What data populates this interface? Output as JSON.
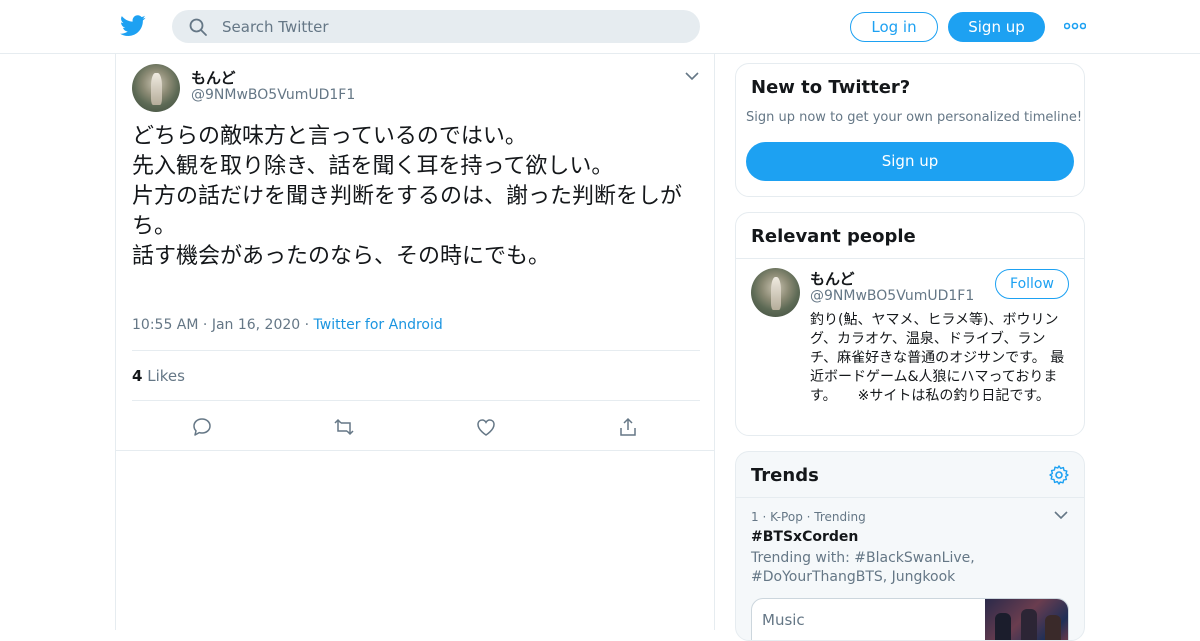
{
  "header": {
    "search_placeholder": "Search Twitter",
    "login_label": "Log in",
    "signup_label": "Sign up",
    "brand_color": "#1da1f2"
  },
  "tweet": {
    "author_name": "もんど",
    "author_handle": "@9NMwBO5VumUD1F1",
    "body_lines": [
      "どちらの敵味方と言っているのではい。",
      "先入観を取り除き、話を聞く耳を持って欲しい。",
      "",
      "片方の話だけを聞き判断をするのは、謝った判断をしがち。",
      "話す機会があったのなら、その時にでも。"
    ],
    "time": "10:55 AM",
    "date": "Jan 16, 2020",
    "source": "Twitter for Android",
    "likes_count": "4",
    "likes_label": "Likes",
    "actions": [
      "reply-icon",
      "retweet-icon",
      "like-icon",
      "share-icon"
    ]
  },
  "sidebar": {
    "new_to_twitter": {
      "title": "New to Twitter?",
      "subtitle": "Sign up now to get your own personalized timeline!",
      "button": "Sign up"
    },
    "relevant_people": {
      "title": "Relevant people",
      "name": "もんど",
      "handle": "@9NMwBO5VumUD1F1",
      "follow_label": "Follow",
      "bio": "釣り(鮎、ヤマメ、ヒラメ等)、ボウリング、カラオケ、温泉、ドライブ、ランチ、麻雀好きな普通のオジサンです。 最近ボードゲーム&人狼にハマっております。　　※サイトは私の釣り日記です。"
    },
    "trends": {
      "title": "Trends",
      "items": [
        {
          "rank": "1",
          "category": "K-Pop",
          "status": "Trending",
          "tag": "#BTSxCorden",
          "trending_with": "Trending with: #BlackSwanLive, #DoYourThangBTS, Jungkook",
          "media_label": "Music"
        }
      ]
    }
  }
}
